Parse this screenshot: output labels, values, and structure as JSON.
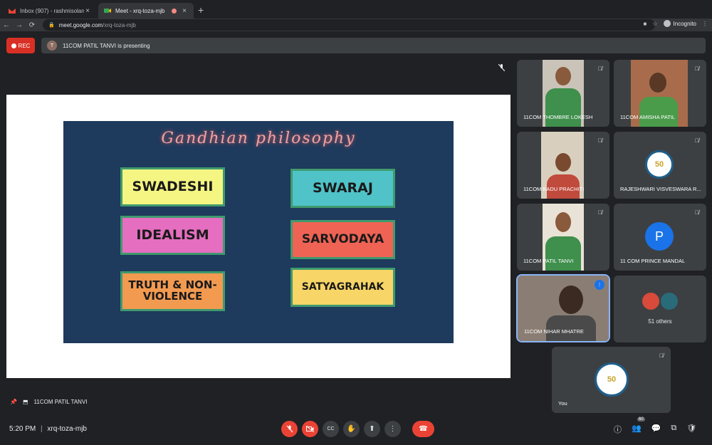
{
  "tabs": [
    {
      "title": "Inbox (907) - rashmisolanki@m",
      "close": "×"
    },
    {
      "title": "Meet - xrq-toza-mjb",
      "close": "×"
    }
  ],
  "new_tab": "+",
  "address": {
    "host": "meet.google.com",
    "path": "/xrq-toza-mjb",
    "lock": "🔒"
  },
  "nav": {
    "back": "←",
    "forward": "→",
    "reload": "⟳"
  },
  "incognito": "Incognito",
  "star": "☆",
  "rec": "REC",
  "presenter_bar": {
    "avatar": "T",
    "text": "11COM PATIL TANVI is presenting"
  },
  "slide": {
    "title": "Gandhian philosophy",
    "cards": [
      "SWADESHI",
      "SWARAJ",
      "IDEALISM",
      "SARVODAYA",
      "TRUTH & NON-VIOLENCE",
      "SATYAGRAHAK"
    ],
    "colors": [
      "#f4f582",
      "#4fc3c8",
      "#e56ec0",
      "#ef6354",
      "#f29a50",
      "#f7d566"
    ]
  },
  "participants": [
    {
      "name": "11COM THOMBRE LOKESH"
    },
    {
      "name": "11COM AMISHA PATIL"
    },
    {
      "name": "11COM KADU PRACHITI"
    },
    {
      "name": "RAJESHWARI VISVESWARA R..."
    },
    {
      "name": "11COM PATIL TANVI"
    },
    {
      "name": "11 COM PRINCE MANDAL",
      "avatar": "P"
    },
    {
      "name": "11COM NIHAR MHATRE"
    }
  ],
  "others": "51 others",
  "you": "You",
  "logo_text": "50",
  "presentation_footer": "11COM PATIL TANVI",
  "meeting_info": {
    "time": "5:20 PM",
    "separator": "|",
    "code": "xrq-toza-mjb"
  },
  "people_count": "60",
  "icons": {
    "mic_off": "🎙",
    "cam_off": "📷",
    "captions": "CC",
    "hand": "✋",
    "present": "⬆",
    "more": "⋮",
    "hangup": "☎",
    "info": "ⓘ",
    "people": "👥",
    "chat": "💬",
    "activities": "⧉",
    "shield": "🛡"
  }
}
